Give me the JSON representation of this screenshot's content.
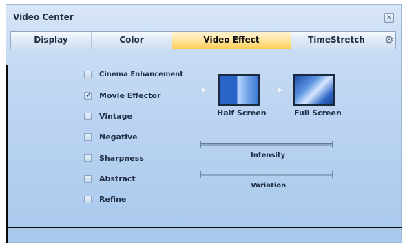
{
  "window": {
    "title": "Video Center",
    "close_icon": "close-icon"
  },
  "tabs": [
    {
      "label": "Display"
    },
    {
      "label": "Color"
    },
    {
      "label": "Video Effect",
      "active": true
    },
    {
      "label": "TimeStretch"
    }
  ],
  "settings_icon": "gear-icon",
  "effects": [
    {
      "label": "Cinema Enhancement",
      "checked": false
    },
    {
      "label": "Movie Effector",
      "checked": true
    },
    {
      "label": "Vintage",
      "checked": false
    },
    {
      "label": "Negative",
      "checked": false
    },
    {
      "label": "Sharpness",
      "checked": false
    },
    {
      "label": "Abstract",
      "checked": false
    },
    {
      "label": "Refine",
      "checked": false
    }
  ],
  "screen_modes": [
    {
      "label": "Half Screen"
    },
    {
      "label": "Full Screen"
    }
  ],
  "sliders": [
    {
      "label": "Intensity"
    },
    {
      "label": "Variation"
    }
  ],
  "colors": {
    "active_tab": "#ffcd56",
    "panel": "#b9d2f0"
  }
}
